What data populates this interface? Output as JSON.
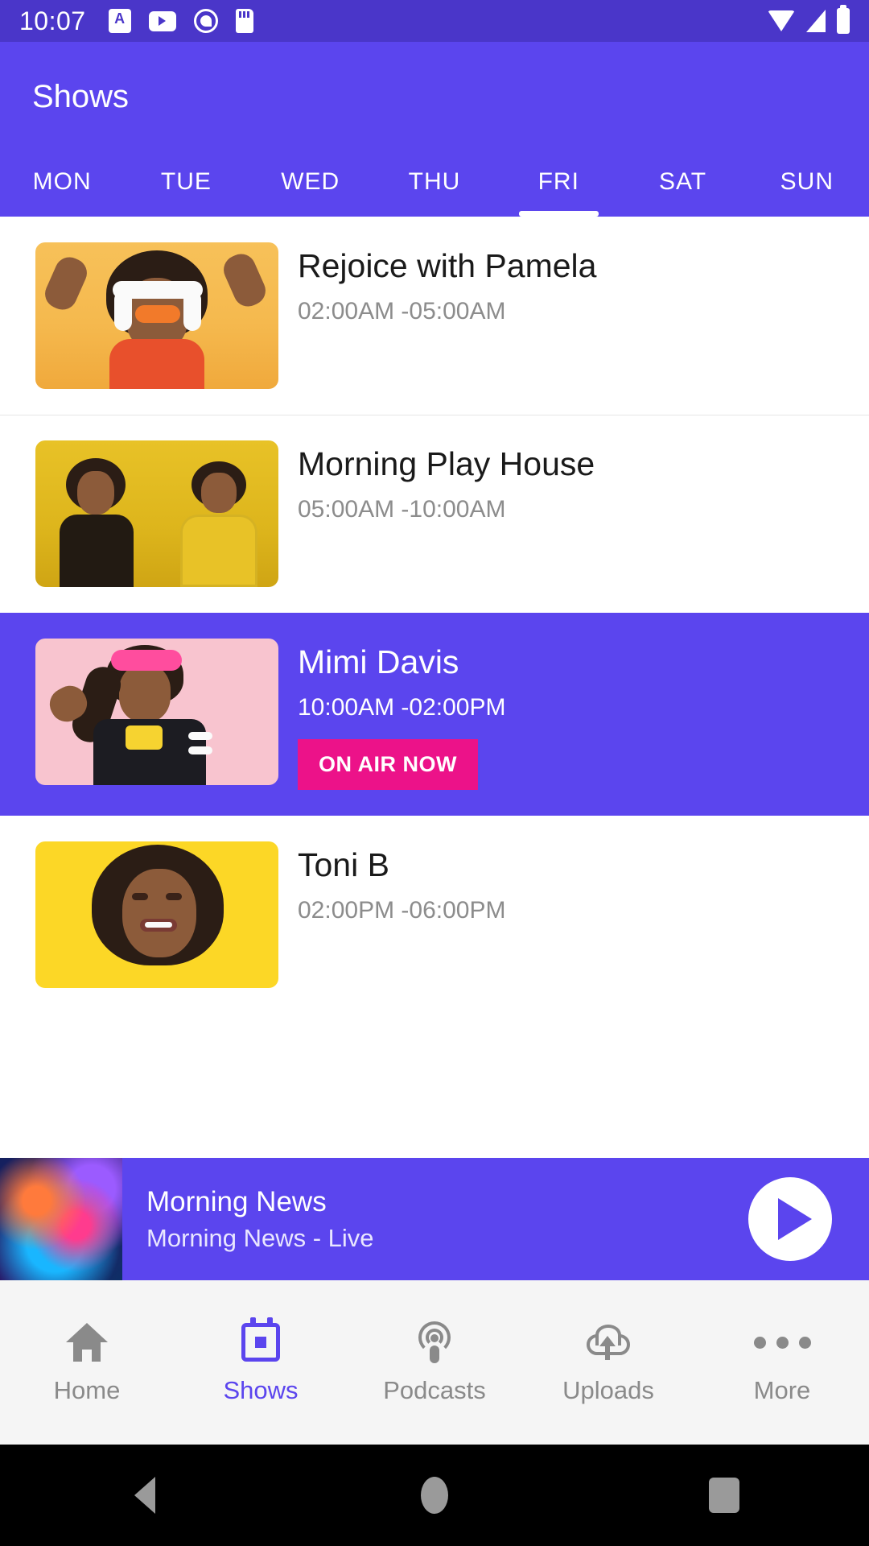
{
  "status_bar": {
    "time": "10:07",
    "icons_left": [
      "translate-icon",
      "youtube-icon",
      "q-circle-icon",
      "sd-card-icon"
    ],
    "icons_right": [
      "wifi-icon",
      "cell-signal-icon",
      "battery-icon"
    ],
    "background": "#4a36c9"
  },
  "app_bar": {
    "title": "Shows",
    "background": "#5b45ee",
    "tabs": [
      {
        "label": "MON",
        "active": false
      },
      {
        "label": "TUE",
        "active": false
      },
      {
        "label": "WED",
        "active": false
      },
      {
        "label": "THU",
        "active": false
      },
      {
        "label": "FRI",
        "active": true
      },
      {
        "label": "SAT",
        "active": false
      },
      {
        "label": "SUN",
        "active": false
      }
    ]
  },
  "shows": [
    {
      "title": "Rejoice with Pamela",
      "time": "02:00AM -05:00AM",
      "on_air": false,
      "badge": ""
    },
    {
      "title": "Morning Play House",
      "time": "05:00AM -10:00AM",
      "on_air": false,
      "badge": ""
    },
    {
      "title": "Mimi Davis",
      "time": "10:00AM -02:00PM",
      "on_air": true,
      "badge": "ON AIR NOW"
    },
    {
      "title": "Toni B",
      "time": "02:00PM -06:00PM",
      "on_air": false,
      "badge": ""
    }
  ],
  "colors": {
    "accent": "#5b45ee",
    "status_bar": "#4a36c9",
    "badge": "#ec1289",
    "muted_text": "#8c8c8c",
    "nav_inactive": "#8a8a8a"
  },
  "player": {
    "title": "Morning News",
    "subtitle": "Morning News - Live",
    "play_icon": "play-icon",
    "artwork": "nebula-artwork"
  },
  "bottom_nav": [
    {
      "label": "Home",
      "icon": "home-icon",
      "active": false
    },
    {
      "label": "Shows",
      "icon": "calendar-icon",
      "active": true
    },
    {
      "label": "Podcasts",
      "icon": "podcast-icon",
      "active": false
    },
    {
      "label": "Uploads",
      "icon": "cloud-upload-icon",
      "active": false
    },
    {
      "label": "More",
      "icon": "more-horizontal-icon",
      "active": false
    }
  ],
  "android_nav": {
    "back": "back-triangle-icon",
    "home": "home-circle-icon",
    "recents": "recents-square-icon"
  }
}
